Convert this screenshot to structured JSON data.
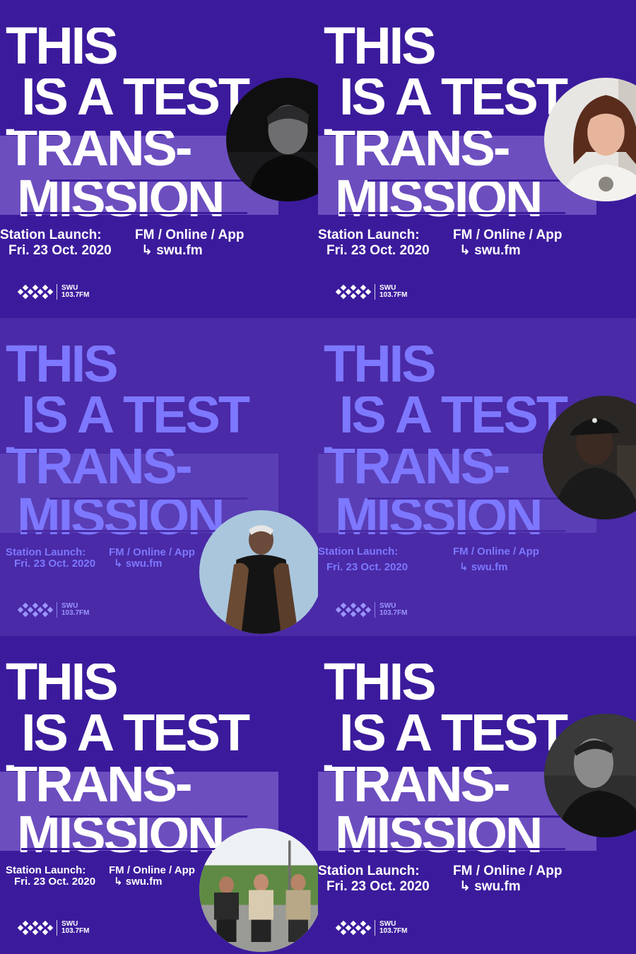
{
  "posters": [
    {
      "headline": [
        "THIS",
        "IS A TEST",
        "TRANS-",
        "MISSION"
      ],
      "launch_label": "Station Launch:",
      "launch_date": "Fri. 23 Oct. 2020",
      "channels": "FM / Online / App",
      "url": "↳ swu.fm",
      "logo_name": "SWU",
      "logo_freq": "103.7FM",
      "photo_alt": "man in black and white portrait"
    },
    {
      "headline": [
        "THIS",
        "IS A TEST",
        "TRANS-",
        "MISSION"
      ],
      "launch_label": "Station Launch:",
      "launch_date": "Fri. 23 Oct. 2020",
      "channels": "FM / Online / App",
      "url": "↳ swu.fm",
      "logo_name": "SWU",
      "logo_freq": "103.7FM",
      "photo_alt": "woman with bangs"
    },
    {
      "headline": [
        "THIS",
        "IS A TEST",
        "TRANS-",
        "MISSION"
      ],
      "launch_label": "Station Launch:",
      "launch_date": "Fri. 23 Oct. 2020",
      "channels": "FM / Online / App",
      "url": "↳ swu.fm",
      "logo_name": "SWU",
      "logo_freq": "103.7FM",
      "photo_alt": "man in leather coat"
    },
    {
      "headline": [
        "THIS",
        "IS A TEST",
        "TRANS-",
        "MISSION"
      ],
      "launch_label": "Station Launch:",
      "launch_date": "Fri. 23 Oct. 2020",
      "channels": "FM / Online / App",
      "url": "↳ swu.fm",
      "logo_name": "SWU",
      "logo_freq": "103.7FM",
      "photo_alt": "man in cap"
    },
    {
      "headline": [
        "THIS",
        "IS A TEST",
        "TRANS-",
        "MISSION"
      ],
      "launch_label": "Station Launch:",
      "launch_date": "Fri. 23 Oct. 2020",
      "channels": "FM / Online / App",
      "url": "↳ swu.fm",
      "logo_name": "SWU",
      "logo_freq": "103.7FM",
      "photo_alt": "three men outdoors"
    },
    {
      "headline": [
        "THIS",
        "IS A TEST",
        "TRANS-",
        "MISSION"
      ],
      "launch_label": "Station Launch:",
      "launch_date": "Fri. 23 Oct. 2020",
      "channels": "FM / Online / App",
      "url": "↳ swu.fm",
      "logo_name": "SWU",
      "logo_freq": "103.7FM",
      "photo_alt": "man in black and white profile"
    }
  ],
  "colors": {
    "background": "#3b1b9c",
    "headline_white": "#ffffff",
    "headline_blue": "#7d78ff"
  }
}
